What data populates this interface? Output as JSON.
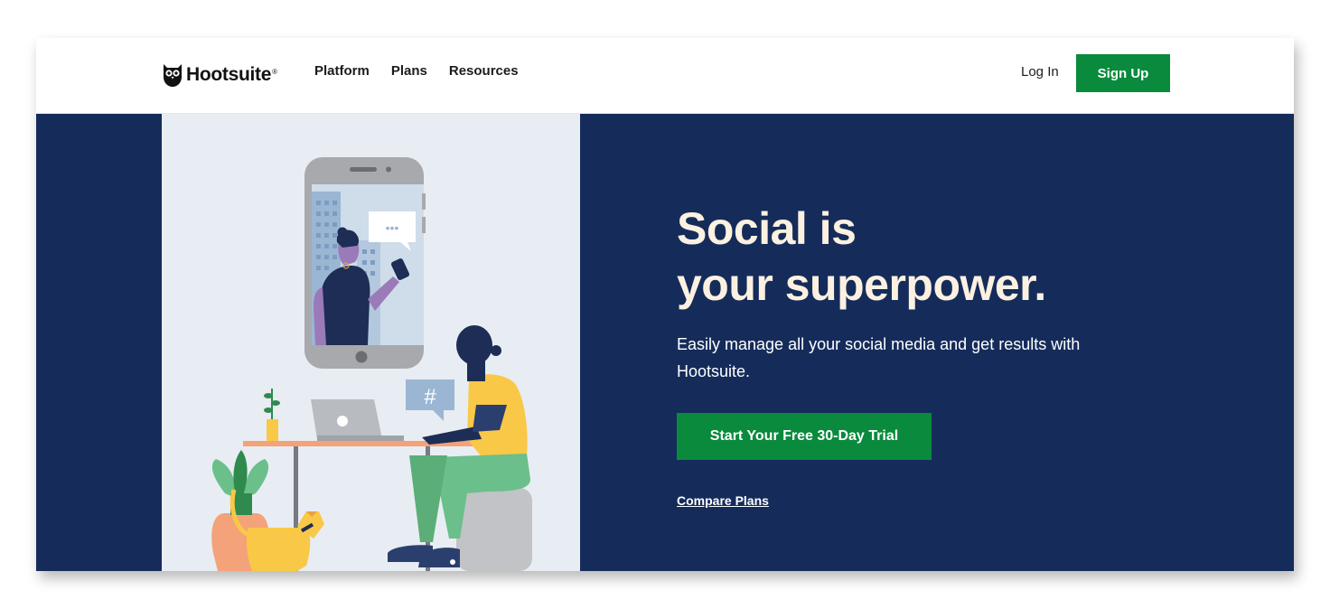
{
  "header": {
    "logo_text": "Hootsuite",
    "logo_mark": "®",
    "nav": [
      {
        "label": "Platform"
      },
      {
        "label": "Plans"
      },
      {
        "label": "Resources"
      }
    ],
    "login_label": "Log In",
    "signup_label": "Sign Up"
  },
  "hero": {
    "headline_line1": "Social is",
    "headline_line2": "your superpower.",
    "subtext": "Easily manage all your social media and get results with Hootsuite.",
    "cta_label": "Start Your Free 30-Day Trial",
    "compare_label": "Compare Plans",
    "illustration": {
      "hashtag": "#",
      "chat_dots": "•••"
    }
  },
  "colors": {
    "brand_green": "#0a8a3c",
    "hero_navy": "#152c5b",
    "headline_cream": "#fcf1e0",
    "illustration_bg": "#e8edf3"
  },
  "icons": [
    "owl-logo-icon",
    "chat-bubble-icon",
    "hashtag-bubble-icon"
  ]
}
